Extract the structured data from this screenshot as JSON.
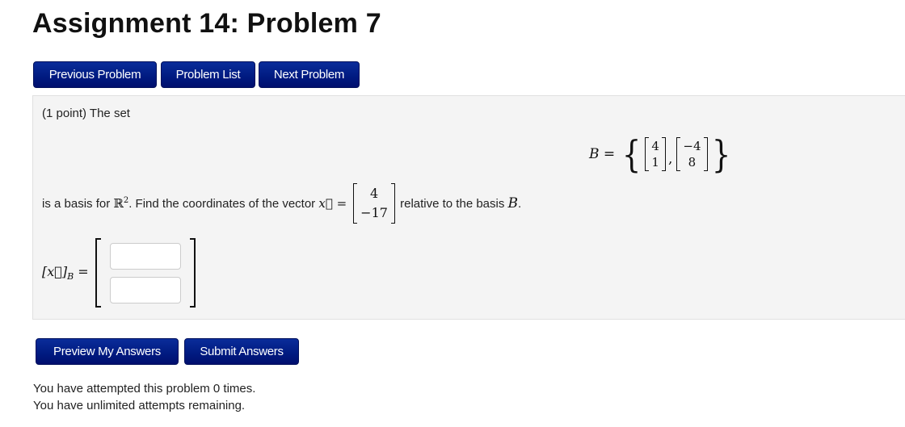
{
  "title": "Assignment 14: Problem 7",
  "nav": {
    "previous_label": "Previous Problem",
    "list_label": "Problem List",
    "next_label": "Next Problem"
  },
  "problem": {
    "intro": "(1 point) The set",
    "set_label": "B =",
    "basis_vectors": [
      [
        "4",
        "1"
      ],
      [
        "−4",
        "8"
      ]
    ],
    "text_before_R": "is a basis for ",
    "R_symbol": "ℝ",
    "R_exponent": "2",
    "text_find": ". Find the coordinates of the vector ",
    "x_vector_label": "x⃗ =",
    "x_vector": [
      "4",
      "−17"
    ],
    "text_after": " relative to the basis ",
    "basis_name": "B",
    "period": ".",
    "answer_label_x": "[x⃗]",
    "answer_label_sub": "B",
    "answer_equals": " =",
    "answer_inputs": [
      {
        "value": "",
        "placeholder": ""
      },
      {
        "value": "",
        "placeholder": ""
      }
    ]
  },
  "actions": {
    "preview_label": "Preview My Answers",
    "submit_label": "Submit Answers"
  },
  "status": {
    "attempted": "You have attempted this problem 0 times.",
    "remaining": "You have unlimited attempts remaining."
  }
}
